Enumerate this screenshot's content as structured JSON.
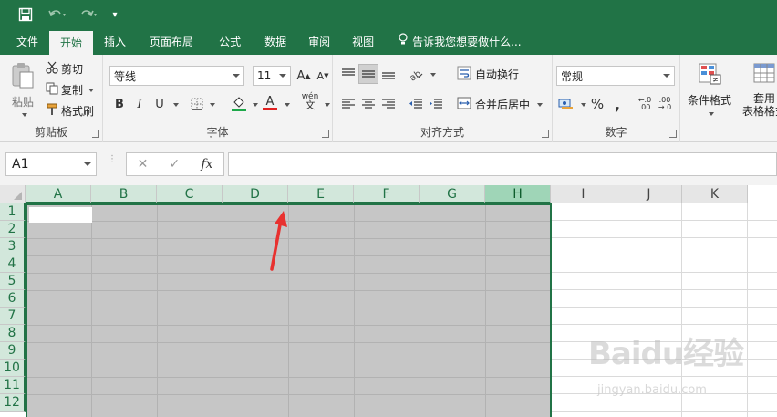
{
  "quick_access": {
    "more": "▾"
  },
  "tabs": [
    {
      "label": "文件"
    },
    {
      "label": "开始",
      "active": true
    },
    {
      "label": "插入"
    },
    {
      "label": "页面布局"
    },
    {
      "label": "公式"
    },
    {
      "label": "数据"
    },
    {
      "label": "审阅"
    },
    {
      "label": "视图"
    }
  ],
  "tell_me": "告诉我您想要做什么...",
  "clipboard": {
    "paste": "粘贴",
    "cut": "剪切",
    "copy": "复制",
    "format_painter": "格式刷",
    "group_label": "剪贴板"
  },
  "font": {
    "font_name": "等线",
    "font_size": "11",
    "bold": "B",
    "italic": "I",
    "underline": "U",
    "group_label": "字体",
    "phonetic": "wén"
  },
  "alignment": {
    "wrap_text": "自动换行",
    "merge_center": "合并后居中",
    "group_label": "对齐方式"
  },
  "number": {
    "format": "常规",
    "percent": "%",
    "comma": ",",
    "group_label": "数字"
  },
  "styles": {
    "conditional_formatting": "条件格式",
    "format_as_table_1": "套用",
    "format_as_table_2": "表格格式"
  },
  "formula_bar": {
    "name_box": "A1",
    "fx": "fx"
  },
  "grid": {
    "columns": [
      "A",
      "B",
      "C",
      "D",
      "E",
      "F",
      "G",
      "H",
      "I",
      "J",
      "K"
    ],
    "rows": [
      "1",
      "2",
      "3",
      "4",
      "5",
      "6",
      "7",
      "8",
      "9",
      "10",
      "11",
      "12"
    ],
    "selected_columns": [
      "A",
      "B",
      "C",
      "D",
      "E",
      "F",
      "G",
      "H"
    ],
    "active_cell": "A1"
  },
  "watermark": {
    "logo": "Baidu经验",
    "url": "jingyan.baidu.com"
  },
  "colors": {
    "excel_green": "#217346",
    "selection_fill": "#c6c6c6",
    "arrow_red": "#e8312f"
  }
}
